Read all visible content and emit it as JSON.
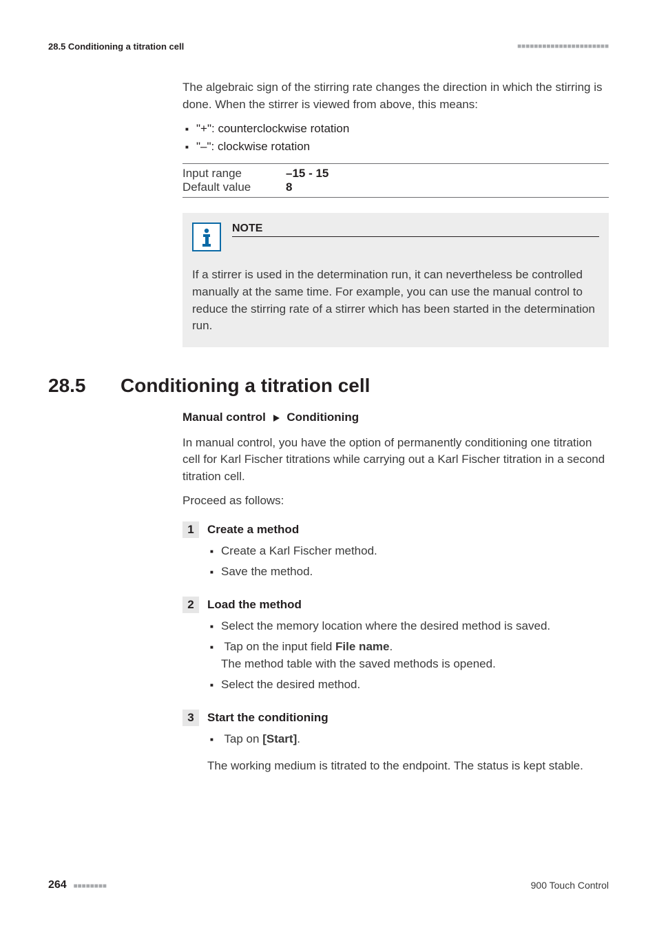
{
  "running_head": {
    "left": "28.5 Conditioning a titration cell",
    "squares": "■■■■■■■■■■■■■■■■■■■■■■"
  },
  "intro": "The algebraic sign of the stirring rate changes the direction in which the stirring is done. When the stirrer is viewed from above, this means:",
  "dir_list": [
    "\"+\": counterclockwise rotation",
    "\"–\": clockwise rotation"
  ],
  "params": {
    "input_range_label": "Input range",
    "input_range_value": "–15 - 15",
    "default_label": "Default value",
    "default_value": "8"
  },
  "note": {
    "title": "NOTE",
    "body": "If a stirrer is used in the determination run, it can nevertheless be controlled manually at the same time. For example, you can use the manual control to reduce the stirring rate of a stirrer which has been started in the determination run."
  },
  "section": {
    "number": "28.5",
    "title": "Conditioning a titration cell"
  },
  "breadcrumb": {
    "a": "Manual control",
    "b": "Conditioning"
  },
  "overview": "In manual control, you have the option of permanently conditioning one titration cell for Karl Fischer titrations while carrying out a Karl Fischer titration in a second titration cell.",
  "proceed": "Proceed as follows:",
  "steps": [
    {
      "num": "1",
      "title": "Create a method",
      "items": [
        {
          "text": "Create a Karl Fischer method."
        },
        {
          "text": "Save the method."
        }
      ]
    },
    {
      "num": "2",
      "title": "Load the method",
      "items": [
        {
          "text": "Select the memory location where the desired method is saved."
        },
        {
          "pre": "Tap on the input field ",
          "bold": "File name",
          "post": ".",
          "sub": "The method table with the saved methods is opened."
        },
        {
          "text": "Select the desired method."
        }
      ]
    },
    {
      "num": "3",
      "title": "Start the conditioning",
      "items": [
        {
          "pre": "Tap on ",
          "bold": "[Start]",
          "post": "."
        }
      ],
      "result": "The working medium is titrated to the endpoint. The status is kept stable."
    }
  ],
  "footer": {
    "page": "264",
    "squares": "■■■■■■■■",
    "device": "900 Touch Control"
  }
}
